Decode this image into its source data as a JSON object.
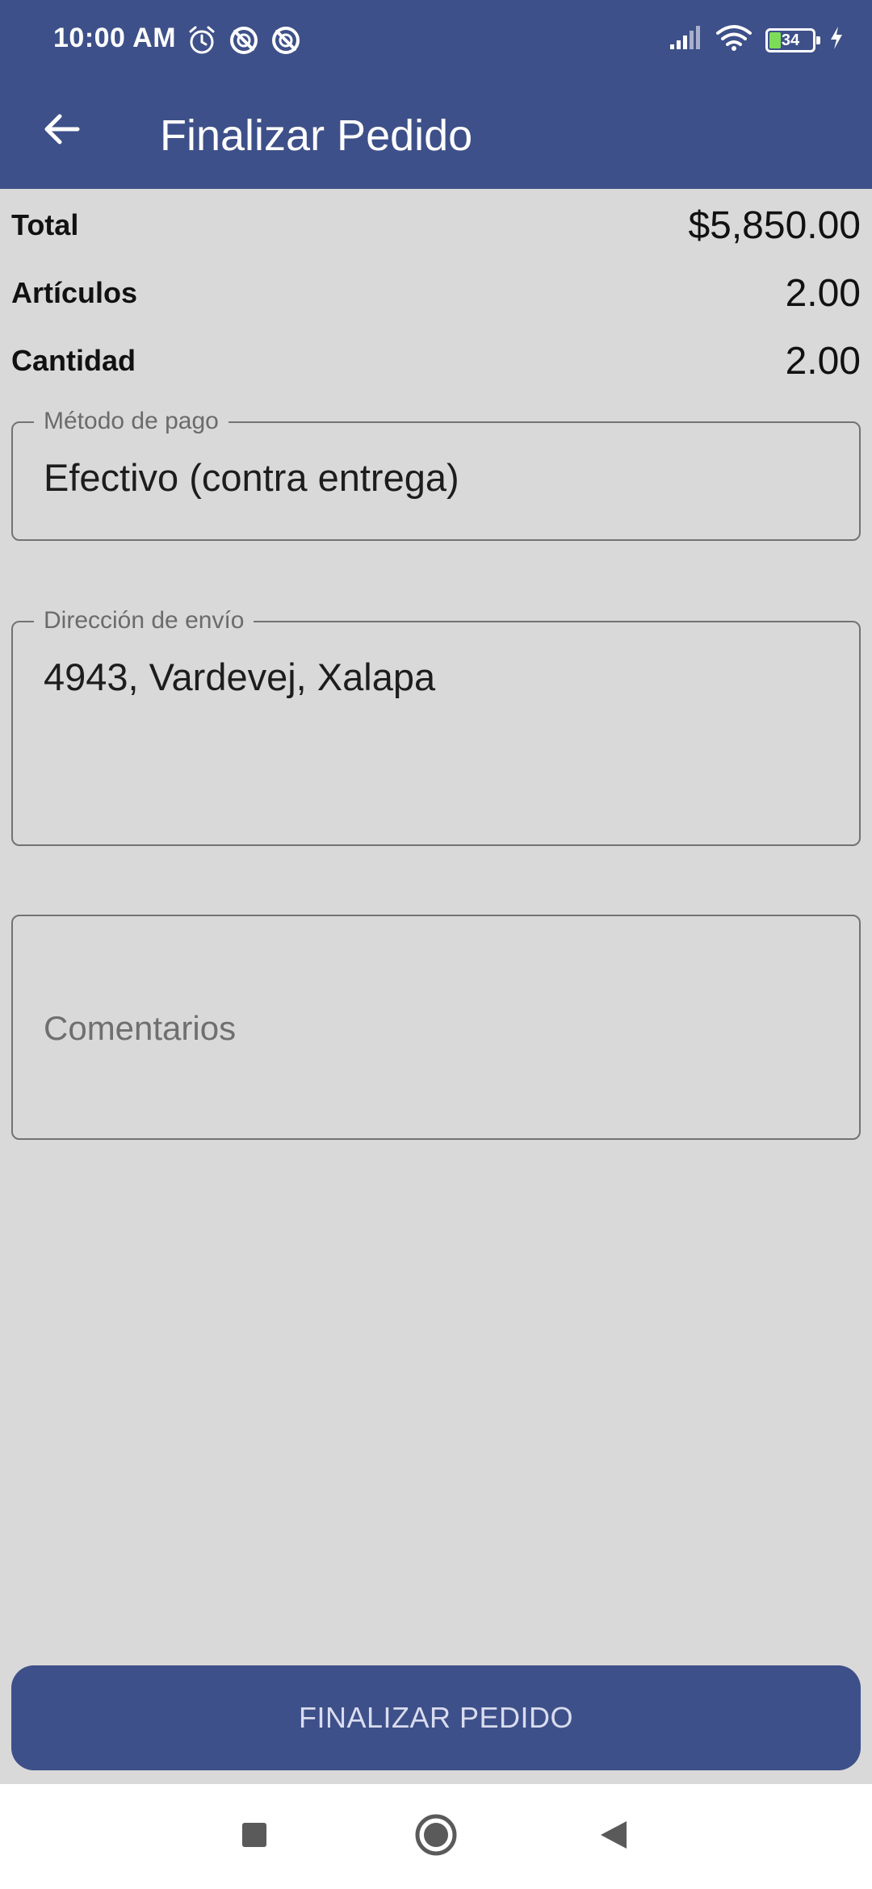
{
  "status_bar": {
    "time": "10:00 AM",
    "battery_level": "34",
    "icons": [
      "alarm-icon",
      "sync-disabled-icon",
      "sync-disabled-icon",
      "signal-icon",
      "wifi-icon",
      "battery-icon",
      "charging-icon"
    ]
  },
  "app_bar": {
    "title": "Finalizar Pedido",
    "back_icon": "arrow-left-icon"
  },
  "summary": [
    {
      "label": "Total",
      "value": "$5,850.00"
    },
    {
      "label": "Artículos",
      "value": "2.00"
    },
    {
      "label": "Cantidad",
      "value": "2.00"
    }
  ],
  "payment_field": {
    "label": "Método de pago",
    "value": "Efectivo (contra entrega)"
  },
  "address_field": {
    "label": "Dirección de envío",
    "value": "4943, Vardevej, Xalapa"
  },
  "comments_field": {
    "placeholder": "Comentarios"
  },
  "submit_button": {
    "label": "FINALIZAR PEDIDO"
  },
  "nav_bar": {
    "icons": [
      "recents-square-icon",
      "home-circle-icon",
      "back-triangle-icon"
    ]
  },
  "colors": {
    "brand": "#3e5089",
    "background": "#d9d9d9",
    "battery_fill": "#7ddc57"
  }
}
